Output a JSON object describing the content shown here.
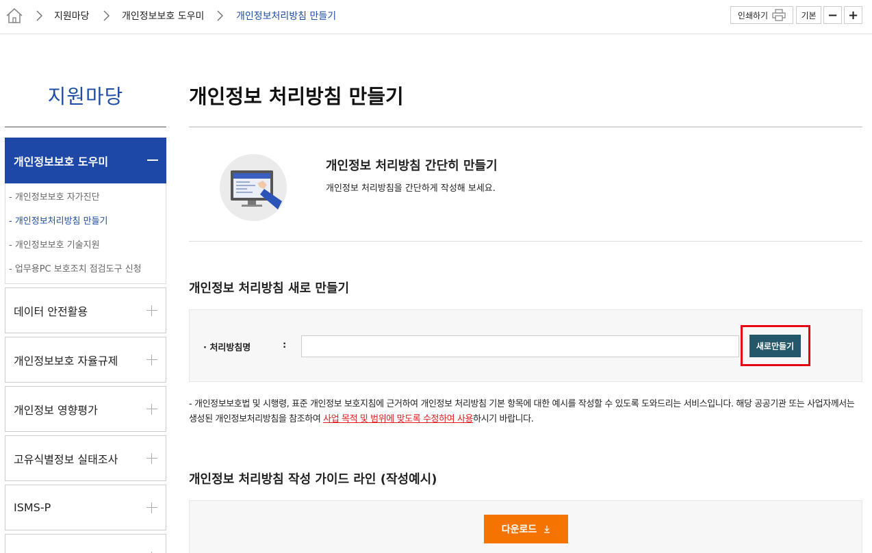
{
  "breadcrumb": [
    "지원마당",
    "개인정보보호 도우미",
    "개인정보처리방침 만들기"
  ],
  "toolbar": {
    "print_label": "인쇄하기",
    "base_label": "기본",
    "minus_label": "−",
    "plus_label": "+"
  },
  "sidebar": {
    "title": "지원마당",
    "active": "개인정보보호 도우미",
    "sub_items": [
      "- 개인정보보호 자가진단",
      "- 개인정보처리방침 만들기",
      "- 개인정보보호 기술지원",
      "- 업무용PC 보호조치 점검도구 신청"
    ],
    "items": [
      "데이터 안전활용",
      "개인정보보호 자율규제",
      "개인정보 영향평가",
      "고유식별정보 실태조사",
      "ISMS-P"
    ]
  },
  "main": {
    "title": "개인정보 처리방침 만들기",
    "intro_title": "개인정보 처리방침 간단히 만들기",
    "intro_desc": "개인정보 처리방침을 간단하게 작성해 보세요.",
    "section_new": "개인정보 처리방침 새로 만들기",
    "form_label": "· 처리방침명",
    "form_colon": ":",
    "input_value": "",
    "new_button": "새로만들기",
    "notice_1": "- 개인정보보호법 및 시행령, 표준 개인정보 보호지침에 근거하여 개인정보 처리방침 기본 항목에 대한 예시를 작성할 수 있도록 도와드리는 서비스입니다. 해당 공공기관 또는 사업자께서는 생성된 개인정보처리방침을 참조하여 ",
    "notice_red": "사업 목적 및 범위에 맞도록 수정하여 사용",
    "notice_2": "하시기 바랍니다.",
    "section_guide": "개인정보 처리방침 작성 가이드 라인 (작성예시)",
    "download_button": "다운로드"
  },
  "colors": {
    "brand_blue": "#1d48a8",
    "teal_button": "#235769",
    "download_orange": "#f57300",
    "highlight_red": "#e60012"
  }
}
